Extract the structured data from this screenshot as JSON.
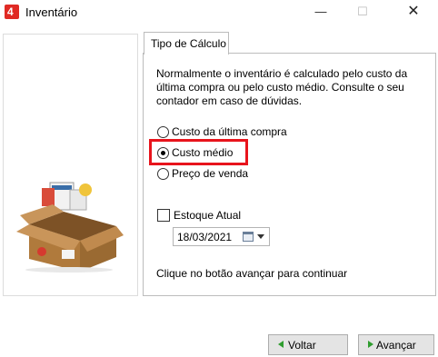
{
  "window": {
    "title": "Inventário",
    "app_icon": "app-logo-icon",
    "minimize": "—",
    "maximize": "☐",
    "close": "✕"
  },
  "tab": {
    "label": "Tipo de Cálculo"
  },
  "description": "Normalmente o inventário é calculado pelo custo da última compra ou pelo custo médio. Consulte o seu contador em caso de dúvidas.",
  "options": [
    {
      "label": "Custo da última compra",
      "checked": false
    },
    {
      "label": "Custo médio",
      "checked": true
    },
    {
      "label": "Preço de venda",
      "checked": false
    }
  ],
  "stock": {
    "label": "Estoque Atual",
    "checked": false,
    "date": "18/03/2021"
  },
  "hint": "Clique no botão avançar para continuar",
  "buttons": {
    "back": "Voltar",
    "next": "Avançar"
  },
  "colors": {
    "highlight": "#e8141c",
    "arrow": "#2e9d2e",
    "logo": "#e02a24"
  }
}
